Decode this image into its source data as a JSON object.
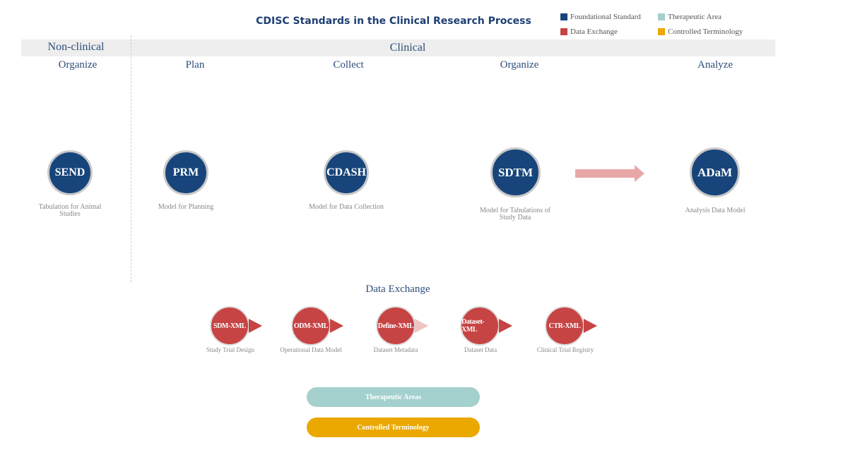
{
  "title": "CDISC Standards in the Clinical Research Process",
  "legend": [
    {
      "label": "Foundational Standard",
      "color": "#17457b"
    },
    {
      "label": "Therapeutic Area",
      "color": "#a4d0cd"
    },
    {
      "label": "Data Exchange",
      "color": "#c74444"
    },
    {
      "label": "Controlled Terminology",
      "color": "#eaa800"
    }
  ],
  "bands": {
    "non_clinical": "Non-clinical",
    "clinical": "Clinical"
  },
  "phases": [
    "Organize",
    "Plan",
    "Collect",
    "Organize",
    "Analyze"
  ],
  "standards": [
    {
      "abbr": "SEND",
      "caption": "Tabulation for Animal Studies"
    },
    {
      "abbr": "PRM",
      "caption": "Model for Planning"
    },
    {
      "abbr": "CDASH",
      "caption": "Model for Data Collection"
    },
    {
      "abbr": "SDTM",
      "caption": "Model for Tabulations of Study Data"
    },
    {
      "abbr": "ADaM",
      "caption": "Analysis Data Model"
    }
  ],
  "data_exchange": {
    "heading": "Data Exchange",
    "items": [
      {
        "abbr": "SDM-XML",
        "caption": "Study Trial Design"
      },
      {
        "abbr": "ODM-XML",
        "caption": "Operational Data Model"
      },
      {
        "abbr": "Define-XML",
        "caption": "Dataset Metadata"
      },
      {
        "abbr": "Dataset-XML",
        "caption": "Dataset Data"
      },
      {
        "abbr": "CTR-XML",
        "caption": "Clinical Trial Registry"
      }
    ]
  },
  "pills": [
    {
      "label": "Therapeutic Areas",
      "color": "#a4d0cd"
    },
    {
      "label": "Controlled Terminology",
      "color": "#eaa800"
    }
  ]
}
